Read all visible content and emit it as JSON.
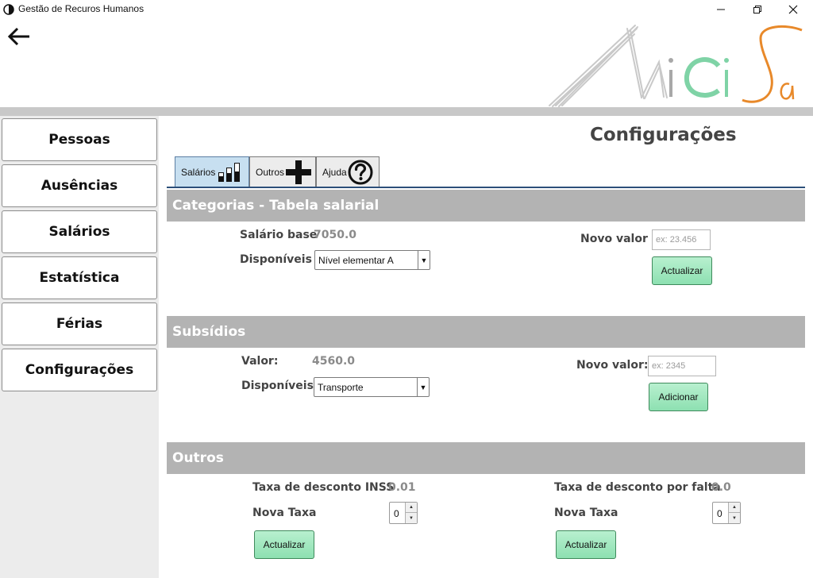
{
  "window": {
    "title": "Gestão de Recuros Humanos"
  },
  "sidebar": {
    "items": [
      {
        "label": "Pessoas"
      },
      {
        "label": "Ausências"
      },
      {
        "label": "Salários"
      },
      {
        "label": "Estatística"
      },
      {
        "label": "Férias"
      },
      {
        "label": "Configurações"
      }
    ]
  },
  "page": {
    "title": "Configurações"
  },
  "tabs": [
    {
      "label": "Salários",
      "icon": "bar-chart-icon",
      "active": true
    },
    {
      "label": "Outros",
      "icon": "plus-icon",
      "active": false
    },
    {
      "label": "Ajuda",
      "icon": "help-icon",
      "active": false
    }
  ],
  "categorias": {
    "header": "Categorias - Tabela salarial",
    "salario_base_label": "Salário base",
    "salario_base_value": "7050.0",
    "disponiveis_label": "Disponíveis",
    "disponiveis_selected": "Nível elementar A",
    "novo_valor_label": "Novo valor",
    "novo_valor_placeholder": "ex: 23.456",
    "button": "Actualizar"
  },
  "subsidios": {
    "header": "Subsídios",
    "valor_label": "Valor:",
    "valor_value": "4560.0",
    "disponiveis_label": "Disponíveis",
    "disponiveis_selected": "Transporte",
    "novo_valor_label": "Novo valor:",
    "novo_valor_placeholder": "ex: 2345",
    "button": "Adicionar"
  },
  "outros": {
    "header": "Outros",
    "inss_label": "Taxa de desconto INSS",
    "inss_value": "0.01",
    "nova_taxa_label": "Nova Taxa",
    "inss_spinner_value": "0",
    "inss_button": "Actualizar",
    "falta_label": "Taxa de desconto por falta",
    "falta_value": "0.0",
    "falta_nova_taxa_label": "Nova Taxa",
    "falta_spinner_value": "0",
    "falta_button": "Actualizar"
  },
  "colors": {
    "section_header": "#b3b3b3",
    "button_green": "#8de0b1",
    "logo_orange": "#e8892a",
    "logo_green": "#7fd3a6"
  }
}
